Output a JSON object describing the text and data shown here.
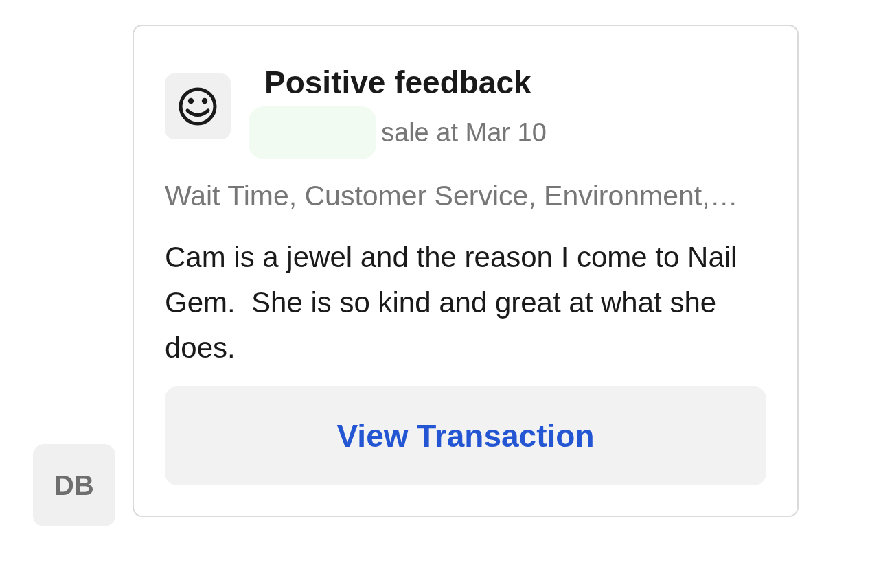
{
  "avatar": {
    "initials": "DB"
  },
  "card": {
    "title": "Positive feedback",
    "subtitle": "sale at Mar 10",
    "tags": "Wait Time, Customer Service, Environment,…",
    "comment": "Cam is a jewel and the reason I come to Nail Gem.  She is so kind and great at what she does.",
    "action": "View Transaction"
  }
}
